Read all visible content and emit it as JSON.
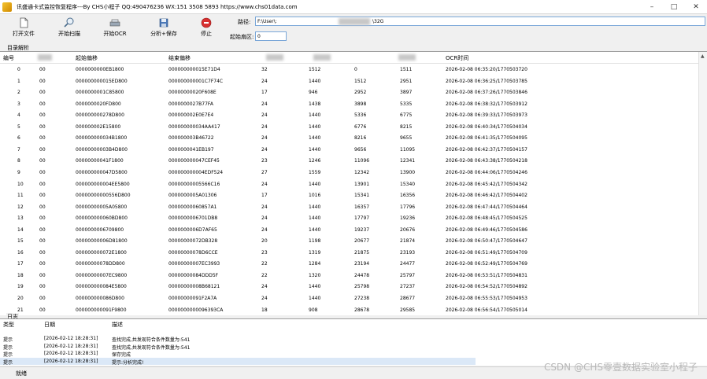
{
  "title": "讯盛通卡式监控恢复程序---By CHS小程子 QQ:490476236 WX:151 3508 5893  https://www.chs01data.com",
  "toolbar": {
    "open": "打开文件",
    "scan": "开始扫描",
    "ocr": "开始OCR",
    "analyze": "分析+保存",
    "stop": "停止"
  },
  "path": {
    "label": "路径:",
    "value": "F:\\User\\:",
    "suffix": "\\32G",
    "start_label": "起始扇区:",
    "start_value": "0"
  },
  "directory_group": "目录解析",
  "columns": [
    "编号",
    "起始偏移",
    "结束偏移",
    "OCR时间"
  ],
  "rows": [
    [
      "0",
      "00",
      "0000000000EB1800",
      "000000000015E71D4",
      "32",
      "1512",
      "0",
      "1511",
      "2026-02-08 06:35:20/1770503720"
    ],
    [
      "1",
      "00",
      "000000000015ED800",
      "000000000001C7F74C",
      "24",
      "1440",
      "1512",
      "2951",
      "2026-02-08 06:36:25/1770503785"
    ],
    [
      "2",
      "00",
      "0000000001C85800",
      "00000000020F608E",
      "17",
      "946",
      "2952",
      "3897",
      "2026-02-08 06:37:26/1770503846"
    ],
    [
      "3",
      "00",
      "0000000020FD800",
      "0000000027B77FA",
      "24",
      "1438",
      "3898",
      "5335",
      "2026-02-08 06:38:32/1770503912"
    ],
    [
      "4",
      "00",
      "000000000278D800",
      "000000002E0E7E4",
      "24",
      "1440",
      "5336",
      "6775",
      "2026-02-08 06:39:33/1770503973"
    ],
    [
      "5",
      "00",
      "000000002E15800",
      "000000000034AA417",
      "24",
      "1440",
      "6776",
      "8215",
      "2026-02-08 06:40:34/1770504034"
    ],
    [
      "6",
      "00",
      "000000000034B1800",
      "000000003B46722",
      "24",
      "1440",
      "8216",
      "9655",
      "2026-02-08 06:41:35/1770504095"
    ],
    [
      "7",
      "00",
      "00000000003B4D800",
      "0000000041EB197",
      "24",
      "1440",
      "9656",
      "11095",
      "2026-02-08 06:42:37/1770504157"
    ],
    [
      "8",
      "00",
      "00000000041F1800",
      "000000000047CEF45",
      "23",
      "1246",
      "11096",
      "12341",
      "2026-02-08 06:43:38/1770504218"
    ],
    [
      "9",
      "00",
      "000000000047D5800",
      "000000000004EDF524",
      "27",
      "1559",
      "12342",
      "13900",
      "2026-02-08 06:44:06/1770504246"
    ],
    [
      "10",
      "00",
      "000000000004EE5800",
      "00000000005566C16",
      "24",
      "1440",
      "13901",
      "15340",
      "2026-02-08 06:45:42/1770504342"
    ],
    [
      "11",
      "00",
      "00000000000556D800",
      "0000000005A01306",
      "17",
      "1016",
      "15341",
      "16356",
      "2026-02-08 06:46:42/1770504402"
    ],
    [
      "12",
      "00",
      "00000000005A05800",
      "00000000060857A1",
      "24",
      "1440",
      "16357",
      "17796",
      "2026-02-08 06:47:44/1770504464"
    ],
    [
      "13",
      "00",
      "000000000060BD800",
      "0000000006701DB8",
      "24",
      "1440",
      "17797",
      "19236",
      "2026-02-08 06:48:45/1770504525"
    ],
    [
      "14",
      "00",
      "0000000006709800",
      "0000000006D7AF65",
      "24",
      "1440",
      "19237",
      "20676",
      "2026-02-08 06:49:46/1770504586"
    ],
    [
      "15",
      "00",
      "00000000006D81800",
      "00000000072DB328",
      "20",
      "1198",
      "20677",
      "21874",
      "2026-02-08 06:50:47/1770504647"
    ],
    [
      "16",
      "00",
      "000000000072E1800",
      "00000000078D6CCE",
      "23",
      "1319",
      "21875",
      "23193",
      "2026-02-08 06:51:49/1770504709"
    ],
    [
      "17",
      "00",
      "00000000078DD800",
      "00000000007EC3993",
      "22",
      "1284",
      "23194",
      "24477",
      "2026-02-08 06:52:49/1770504769"
    ],
    [
      "18",
      "00",
      "00000000007EC9800",
      "00000000084DDD5F",
      "22",
      "1320",
      "24478",
      "25797",
      "2026-02-08 06:53:51/1770504831"
    ],
    [
      "19",
      "00",
      "000000000084E5800",
      "00000000008B68121",
      "24",
      "1440",
      "25798",
      "27237",
      "2026-02-08 06:54:52/1770504892"
    ],
    [
      "20",
      "00",
      "000000000086D800",
      "00000000091F2A7A",
      "24",
      "1440",
      "27238",
      "28677",
      "2026-02-08 06:55:53/1770504953"
    ],
    [
      "21",
      "00",
      "000000000091F9800",
      "0000000000096393CA",
      "18",
      "908",
      "28678",
      "29585",
      "2026-02-08 06:56:54/1770505014"
    ]
  ],
  "log_group": "日志",
  "log_columns": [
    "类型",
    "日期",
    "描述"
  ],
  "log_rows": [
    [
      "提示",
      "[2026-02-12 18:28:31]",
      "查找完成,共发现符合条件数量为:541"
    ],
    [
      "提示",
      "[2026-02-12 18:28:31]",
      "查找完成,共发现符合条件数量为:541"
    ],
    [
      "提示",
      "[2026-02-12 18:28:31]",
      "保存完成"
    ],
    [
      "提示",
      "[2026-02-12 18:28:31]",
      "提示:分析完成!"
    ]
  ],
  "status": "就绪",
  "watermark": "CSDN @CHS零壹数据实验室小程子",
  "colors": {
    "accent": "#0078d7",
    "selection": "#dbe8f7",
    "input_border": "#7aa7d8"
  }
}
